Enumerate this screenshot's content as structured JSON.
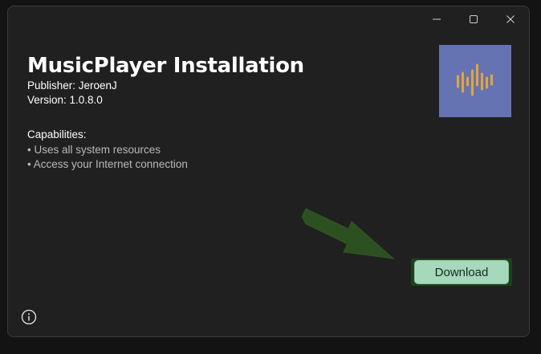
{
  "window": {
    "controls": {
      "minimize_icon": "minimize-icon",
      "maximize_icon": "maximize-icon",
      "close_icon": "close-icon"
    }
  },
  "installer": {
    "title": "MusicPlayer Installation",
    "publisher": "Publisher: JeroenJ",
    "version": "Version: 1.0.8.0",
    "capabilities_heading": "Capabilities:",
    "capabilities": [
      "• Uses all system resources",
      "• Access your Internet connection"
    ],
    "logo_icon": "audio-waveform-icon",
    "download_label": "Download",
    "info_icon": "info-icon"
  },
  "colors": {
    "window_bg": "#202020",
    "logo_bg": "#6673b3",
    "logo_bars": "#e3a53a",
    "button_bg": "#a6d8bb",
    "button_highlight": "#1c4318",
    "arrow": "#2c5020"
  }
}
